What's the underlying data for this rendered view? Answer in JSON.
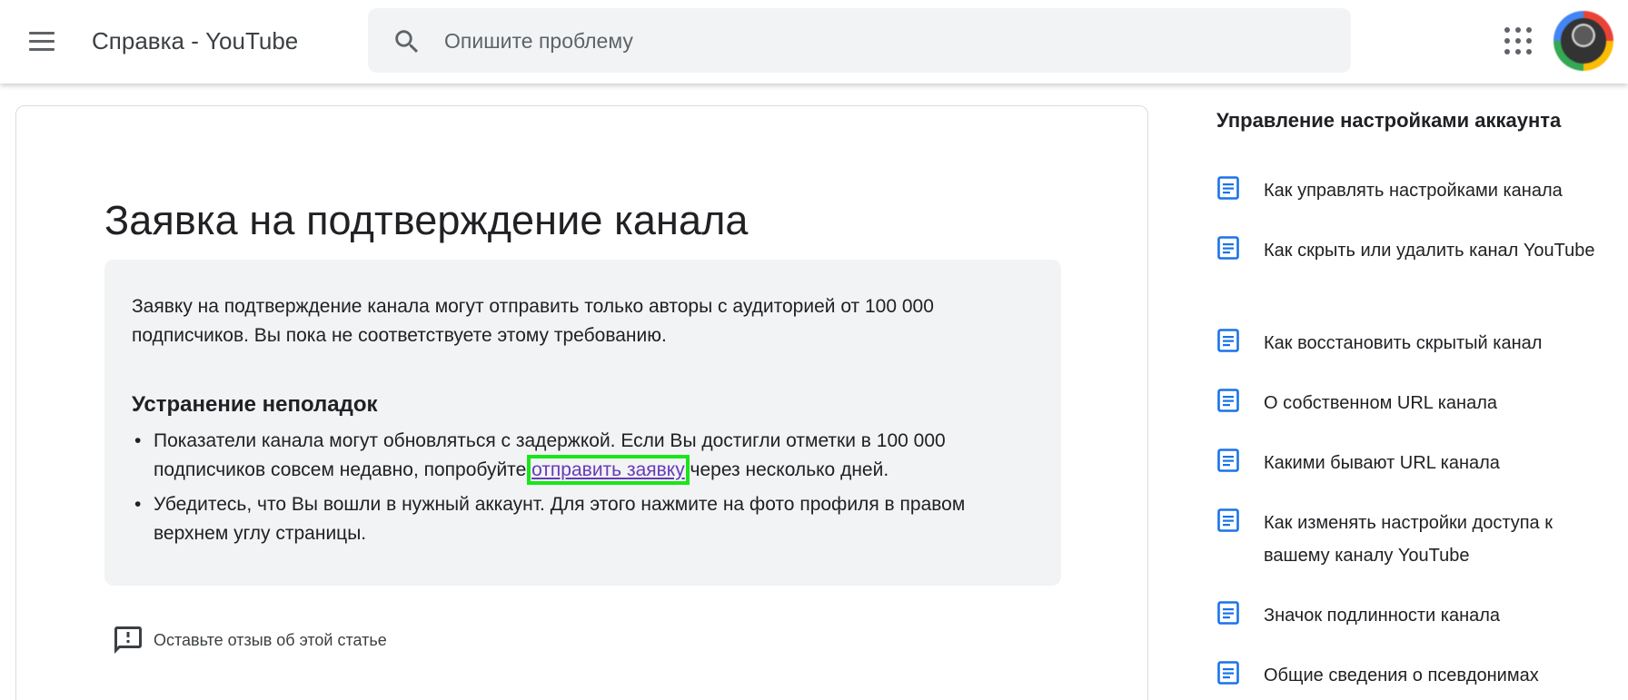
{
  "header": {
    "title": "Справка - YouTube",
    "search_placeholder": "Опишите проблему",
    "icons": {
      "menu": "menu-icon",
      "search": "search-icon",
      "apps": "apps-grid-icon",
      "avatar": "avatar"
    }
  },
  "article": {
    "title": "Заявка на подтверждение канала",
    "info_text": "Заявку на подтверждение канала могут отправить только авторы с аудиторией от 100 000 подписчиков. Вы пока не соответствуете этому требованию.",
    "troubleshooting_heading": "Устранение неполадок",
    "bullet1_before": "Показатели канала могут обновляться с задержкой. Если Вы достигли отметки в 100 000 подписчиков совсем недавно, попробуйте ",
    "bullet1_link": "отправить заявку",
    "bullet1_after": " через несколько дней.",
    "bullet2": "Убедитесь, что Вы вошли в нужный аккаунт. Для этого нажмите на фото профиля в правом верхнем углу страницы.",
    "feedback_label": "Оставьте отзыв об этой статье",
    "link_color": "#673ab7",
    "highlight_color": "#19e619"
  },
  "sidebar": {
    "heading": "Управление настройками аккаунта",
    "icon_color": "#1a73e8",
    "items": [
      {
        "label": "Как управлять настройками канала"
      },
      {
        "label": "Как скрыть или удалить канал YouTube"
      },
      {
        "label": "Как восстановить скрытый канал"
      },
      {
        "label": "О собственном URL канала"
      },
      {
        "label": "Какими бывают URL канала"
      },
      {
        "label": "Как изменять настройки доступа к вашему каналу YouTube"
      },
      {
        "label": "Значок подлинности канала"
      },
      {
        "label": "Общие сведения о псевдонимах"
      }
    ]
  }
}
